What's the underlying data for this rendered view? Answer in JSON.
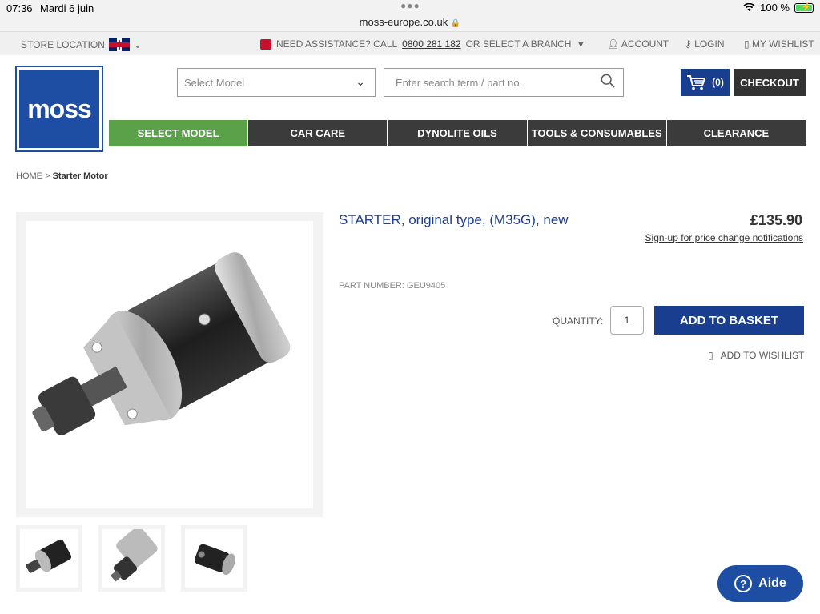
{
  "status": {
    "time": "07:36",
    "date": "Mardi 6 juin",
    "battery": "100 %"
  },
  "browser": {
    "url": "moss-europe.co.uk"
  },
  "topbar": {
    "store_location": "STORE LOCATION",
    "assistance_prefix": "NEED ASSISTANCE? CALL",
    "phone": "0800 281 182",
    "assistance_suffix": "OR SELECT A BRANCH",
    "account": "ACCOUNT",
    "login": "LOGIN",
    "wishlist": "MY WISHLIST"
  },
  "header": {
    "logo_text": "moss",
    "select_model_placeholder": "Select Model",
    "search_placeholder": "Enter search term / part no.",
    "cart_count": "(0)",
    "checkout": "CHECKOUT"
  },
  "nav": [
    "SELECT MODEL",
    "CAR CARE",
    "DYNOLITE OILS",
    "TOOLS & CONSUMABLES",
    "CLEARANCE"
  ],
  "breadcrumb": {
    "home": "HOME",
    "separator": ">",
    "current": "Starter Motor"
  },
  "product": {
    "title": "STARTER, original type, (M35G), new",
    "price": "£135.90",
    "price_notify": "Sign-up for price change notifications",
    "part_number": "PART NUMBER: GEU9405",
    "quantity_label": "QUANTITY:",
    "quantity": "1",
    "add_to_basket": "ADD TO BASKET",
    "add_to_wishlist": "ADD TO WISHLIST"
  },
  "help": {
    "label": "Aide"
  },
  "colors": {
    "brand_blue": "#1d4ea3",
    "button_blue": "#1a3e8f",
    "nav_dark": "#3b3b3b",
    "nav_active": "#5aa14a",
    "title_blue": "#1d3d8f"
  }
}
